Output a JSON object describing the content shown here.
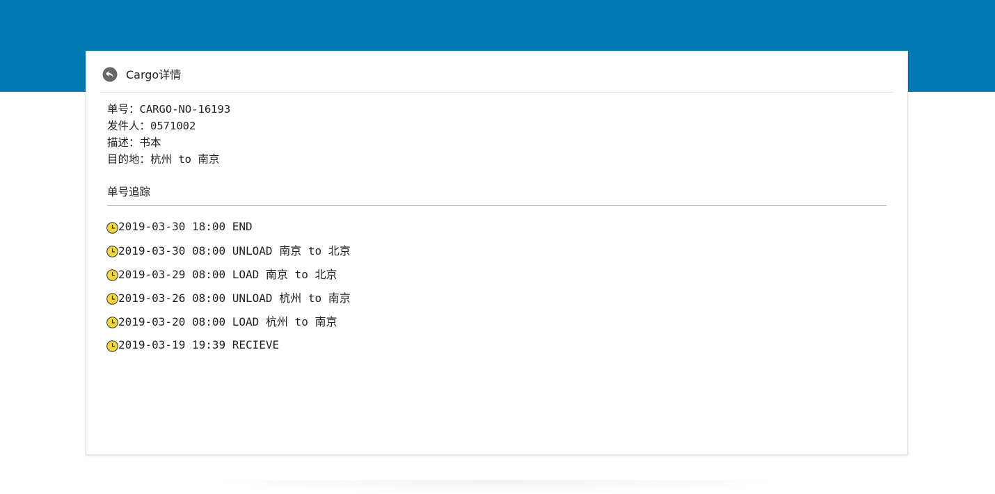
{
  "header": {
    "title": "Cargo详情",
    "back_icon": "back-arrow-circle-icon"
  },
  "info": {
    "order_no": "单号：CARGO-NO-16193",
    "sender": "发件人：0571002",
    "description": "描述：书本",
    "destination": "目的地：杭州 to 南京"
  },
  "tracking": {
    "title": "单号追踪",
    "icon": "clock-icon",
    "icon_color": "#f5d442",
    "events": [
      {
        "text": "2019-03-30 18:00 END"
      },
      {
        "text": "2019-03-30 08:00 UNLOAD 南京 to 北京"
      },
      {
        "text": "2019-03-29 08:00 LOAD 南京 to 北京"
      },
      {
        "text": "2019-03-26 08:00 UNLOAD 杭州 to 南京"
      },
      {
        "text": "2019-03-20 08:00 LOAD 杭州 to 南京"
      },
      {
        "text": "2019-03-19 19:39 RECIEVE"
      }
    ]
  },
  "colors": {
    "topbar": "#017ab3",
    "card_bg": "#ffffff"
  }
}
